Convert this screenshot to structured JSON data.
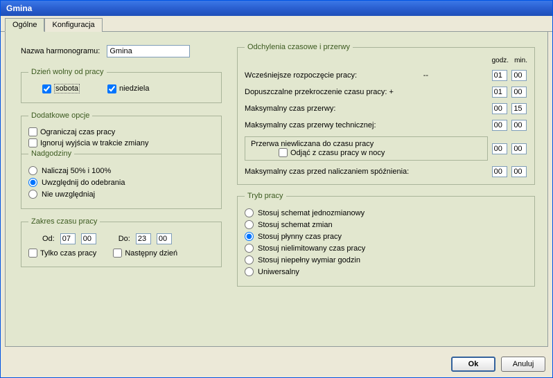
{
  "window": {
    "title": "Gmina"
  },
  "tabs": {
    "general": "Ogólne",
    "config": "Konfiguracja"
  },
  "left": {
    "schedule_label": "Nazwa harmonogramu:",
    "schedule_value": "Gmina",
    "dayoff": {
      "legend": "Dzień wolny od pracy",
      "saturday": "sobota",
      "sunday": "niedziela"
    },
    "extra": {
      "legend": "Dodatkowe opcje",
      "limit": "Ograniczaj czas pracy",
      "ignore": "Ignoruj wyjścia w trakcie zmiany"
    },
    "overtime": {
      "legend": "Nadgodziny",
      "opt1": "Naliczaj 50% i 100%",
      "opt2": "Uwzględnij do odebrania",
      "opt3": "Nie uwzględniaj"
    },
    "range": {
      "legend": "Zakres czasu pracy",
      "from": "Od:",
      "to": "Do:",
      "from_h": "07",
      "from_m": "00",
      "to_h": "23",
      "to_m": "00",
      "onlywork": "Tylko czas pracy",
      "nextday": "Następny dzień"
    }
  },
  "right": {
    "dev": {
      "legend": "Odchylenia czasowe i przerwy",
      "header_h": "godz.",
      "header_m": "min.",
      "early": "Wcześniejsze rozpoczęcie pracy:",
      "early_sign": "--",
      "early_h": "01",
      "early_m": "00",
      "over": "Dopuszczalne przekroczenie czasu pracy:",
      "over_sign": "+",
      "over_h": "01",
      "over_m": "00",
      "break": "Maksymalny czas przerwy:",
      "break_h": "00",
      "break_m": "15",
      "tech": "Maksymalny czas przerwy technicznej:",
      "tech_h": "00",
      "tech_m": "00",
      "excl": "Przerwa niewliczana do czasu pracy",
      "excl_night": "Odjąć z czasu pracy w nocy",
      "excl_h": "00",
      "excl_m": "00",
      "late": "Maksymalny czas przed naliczaniem spóźnienia:",
      "late_h": "00",
      "late_m": "00"
    },
    "mode": {
      "legend": "Tryb pracy",
      "m1": "Stosuj schemat jednozmianowy",
      "m2": "Stosuj schemat zmian",
      "m3": "Stosuj płynny czas pracy",
      "m4": "Stosuj nielimitowany czas pracy",
      "m5": "Stosuj niepełny wymiar godzin",
      "m6": "Uniwersalny"
    }
  },
  "buttons": {
    "ok": "Ok",
    "cancel": "Anuluj"
  }
}
